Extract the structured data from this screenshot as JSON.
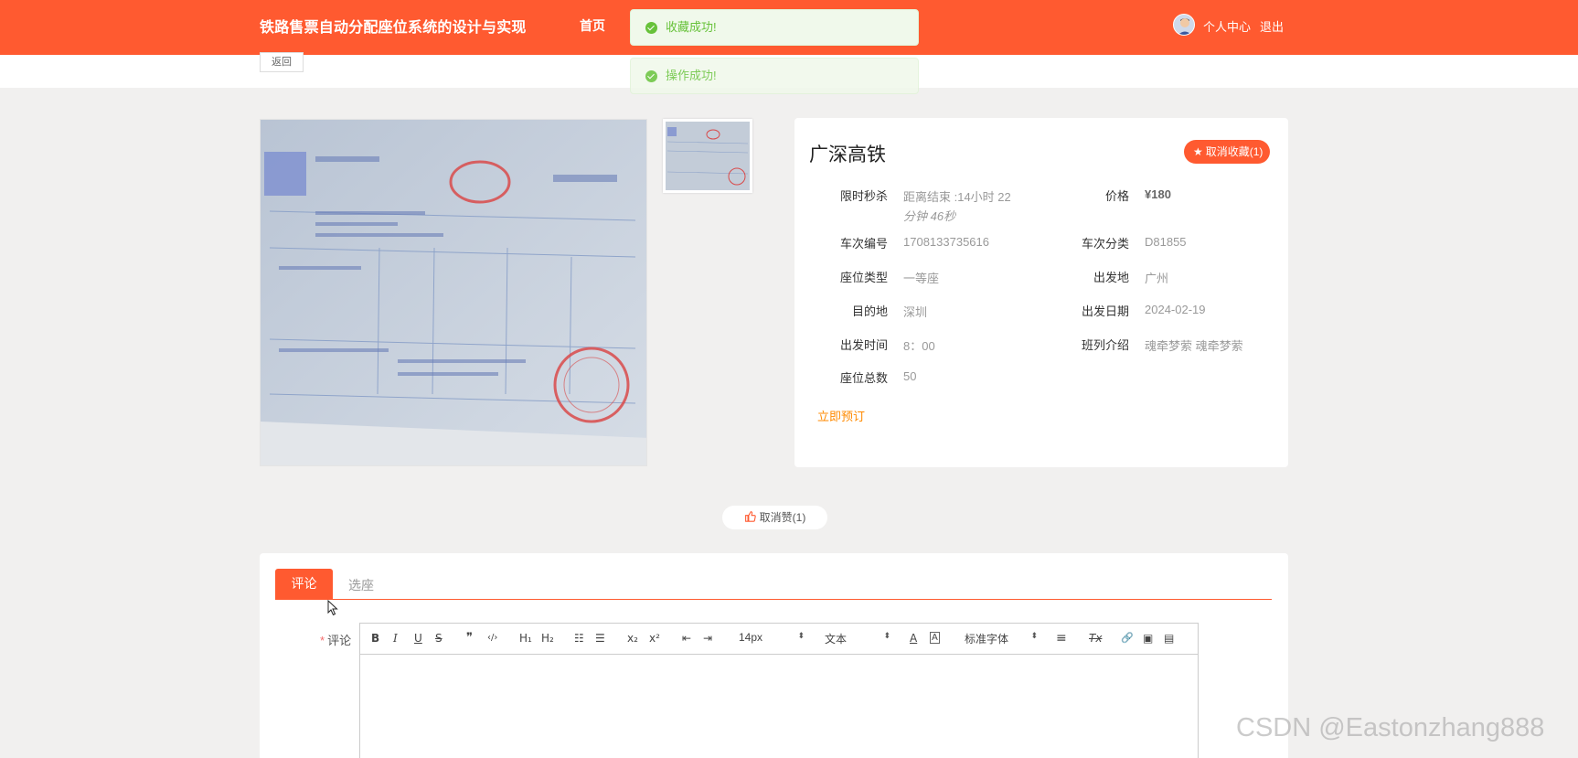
{
  "header": {
    "site_title": "铁路售票自动分配座位系统的设计与实现",
    "nav_home": "首页",
    "user_center": "个人中心",
    "logout": "退出"
  },
  "toasts": [
    {
      "message": "收藏成功!"
    },
    {
      "message": "操作成功!"
    }
  ],
  "back_label": "返回",
  "product": {
    "title": "广深高铁",
    "favorite_label": "取消收藏(1)",
    "fields": [
      {
        "label": "限时秒杀",
        "value": "距离结束 :14小时 22"
      },
      {
        "label": "价格",
        "value": "¥180"
      },
      {
        "label": "车次编号",
        "value": "1708133735616"
      },
      {
        "label": "车次分类",
        "value": "D81855"
      },
      {
        "label": "座位类型",
        "value": "一等座"
      },
      {
        "label": "出发地",
        "value": "广州"
      },
      {
        "label": "目的地",
        "value": "深圳"
      },
      {
        "label": "出发日期",
        "value": "2024-02-19"
      },
      {
        "label": "出发时间",
        "value": "8：00"
      },
      {
        "label": "班列介绍",
        "value": "魂牵梦萦 魂牵梦萦"
      },
      {
        "label": "座位总数",
        "value": "50"
      }
    ],
    "countdown_line2": "分钟 46秒",
    "book_now": "立即预订"
  },
  "like_label": "取消赞(1)",
  "tabs": [
    {
      "label": "评论",
      "active": true
    },
    {
      "label": "选座",
      "active": false
    }
  ],
  "comment": {
    "required_mark": "*",
    "label": "评论",
    "toolbar": {
      "bold": "B",
      "italic": "I",
      "underline": "U",
      "strike": "S",
      "quote": "❞",
      "code": "‹/›",
      "h1": "H₁",
      "h2": "H₂",
      "ordered_list": "☷",
      "bullet_list": "☰",
      "subscript": "x₂",
      "superscript": "x²",
      "outdent": "⇤",
      "indent": "⇥",
      "size_value": "14px",
      "format_value": "文本",
      "color": "A",
      "background": "A",
      "font_value": "标准字体",
      "align": "≡",
      "clear": "Tx",
      "link": "🔗",
      "image": "▣",
      "video": "▤",
      "caret": "⬍"
    }
  },
  "watermark": "CSDN @Eastonzhang888",
  "colors": {
    "brand": "#ff5a30",
    "success": "#67c23a",
    "link": "#ff8a00"
  }
}
